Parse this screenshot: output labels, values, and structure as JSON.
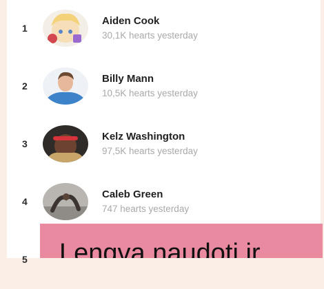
{
  "leaderboard": {
    "items": [
      {
        "rank": "1",
        "name": "Aiden Cook",
        "subtitle": "30,1K hearts yesterday",
        "avatar": "cartoon-avatar"
      },
      {
        "rank": "2",
        "name": "Billy Mann",
        "subtitle": "10,5K hearts yesterday",
        "avatar": "smiling-man-photo"
      },
      {
        "rank": "3",
        "name": "Kelz Washington",
        "subtitle": "97,5K hearts yesterday",
        "avatar": "man-red-headband-photo"
      },
      {
        "rank": "4",
        "name": "Caleb Green",
        "subtitle": "747 hearts yesterday",
        "avatar": "dancer-photo"
      },
      {
        "rank": "5"
      }
    ]
  },
  "callout": {
    "text": "Lengva naudoti ir",
    "color": "#e98aa0"
  }
}
